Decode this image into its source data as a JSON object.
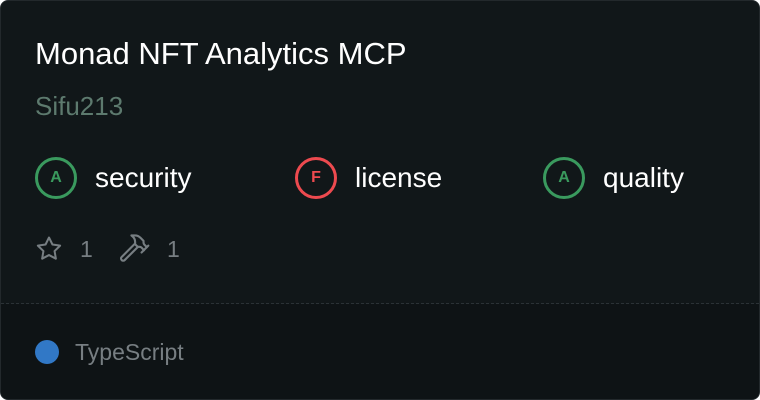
{
  "card": {
    "title": "Monad NFT Analytics MCP",
    "author": "Sifu213"
  },
  "grades": [
    {
      "grade": "A",
      "label": "security",
      "status": "pass",
      "color": "#3a9a5e"
    },
    {
      "grade": "F",
      "label": "license",
      "status": "fail",
      "color": "#ed4a4f"
    },
    {
      "grade": "A",
      "label": "quality",
      "status": "pass",
      "color": "#3a9a5e"
    }
  ],
  "stats": {
    "stars": "1",
    "tools": "1",
    "stars_icon": "star-icon",
    "tools_icon": "hammer-icon"
  },
  "language": {
    "name": "TypeScript",
    "color": "#3178c6"
  },
  "colors": {
    "background": "#111719",
    "footer_background": "#0e1315",
    "author_text": "#5d7a6e",
    "muted_text": "#777e82"
  }
}
